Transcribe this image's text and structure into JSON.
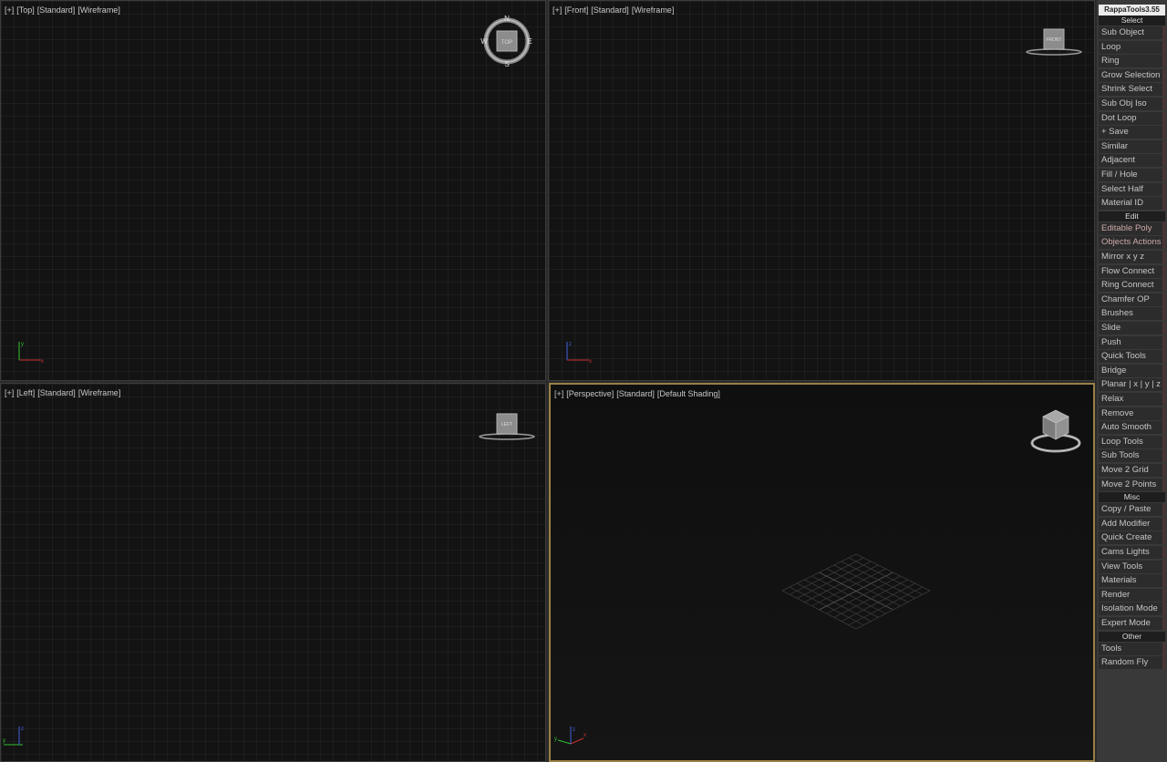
{
  "viewports": {
    "top": {
      "plus": "[+]",
      "view": "[Top]",
      "shading": "[Standard]",
      "mode": "[Wireframe]",
      "cube_label": "TOP",
      "compass": [
        "N",
        "E",
        "S",
        "W"
      ]
    },
    "front": {
      "plus": "[+]",
      "view": "[Front]",
      "shading": "[Standard]",
      "mode": "[Wireframe]",
      "cube_label": "FRONT"
    },
    "left": {
      "plus": "[+]",
      "view": "[Left]",
      "shading": "[Standard]",
      "mode": "[Wireframe]",
      "cube_label": "LEFT"
    },
    "perspective": {
      "plus": "[+]",
      "view": "[Perspective]",
      "shading": "[Standard]",
      "mode": "[Default Shading]"
    }
  },
  "panel": {
    "title": "RappaTools3.55",
    "sections": {
      "select": "Select",
      "edit": "Edit",
      "misc": "Misc",
      "other": "Other"
    },
    "select_items": [
      "Sub Object",
      "Loop",
      "Ring",
      "Grow Selection",
      "Shrink Select",
      "Sub Obj Iso",
      "Dot Loop",
      "+ Save",
      "Similar",
      "Adjacent",
      "Fill / Hole",
      "Select Half",
      "Material ID"
    ],
    "edit_items": [
      "Editable Poly",
      "Objects Actions",
      "Mirror   x  y  z",
      "Flow Connect",
      "Ring Connect",
      "Chamfer OP",
      "Brushes",
      "Slide",
      "Push",
      "Quick Tools",
      "Bridge",
      "Planar | x | y | z",
      "Relax",
      "Remove",
      "Auto Smooth",
      "Loop Tools",
      "Sub Tools",
      "Move 2 Grid",
      "Move 2 Points"
    ],
    "misc_items": [
      "Copy / Paste",
      "Add Modifier",
      "Quick Create",
      "Cams Lights",
      "View Tools",
      "Materials",
      "Render",
      "Isolation Mode",
      "Expert Mode"
    ],
    "other_items": [
      "Tools",
      "Random Fly"
    ]
  },
  "colors": {
    "accent_border": "#9a8047",
    "axis_x": "#d03030",
    "axis_y": "#30c030",
    "axis_z": "#4060e0"
  }
}
